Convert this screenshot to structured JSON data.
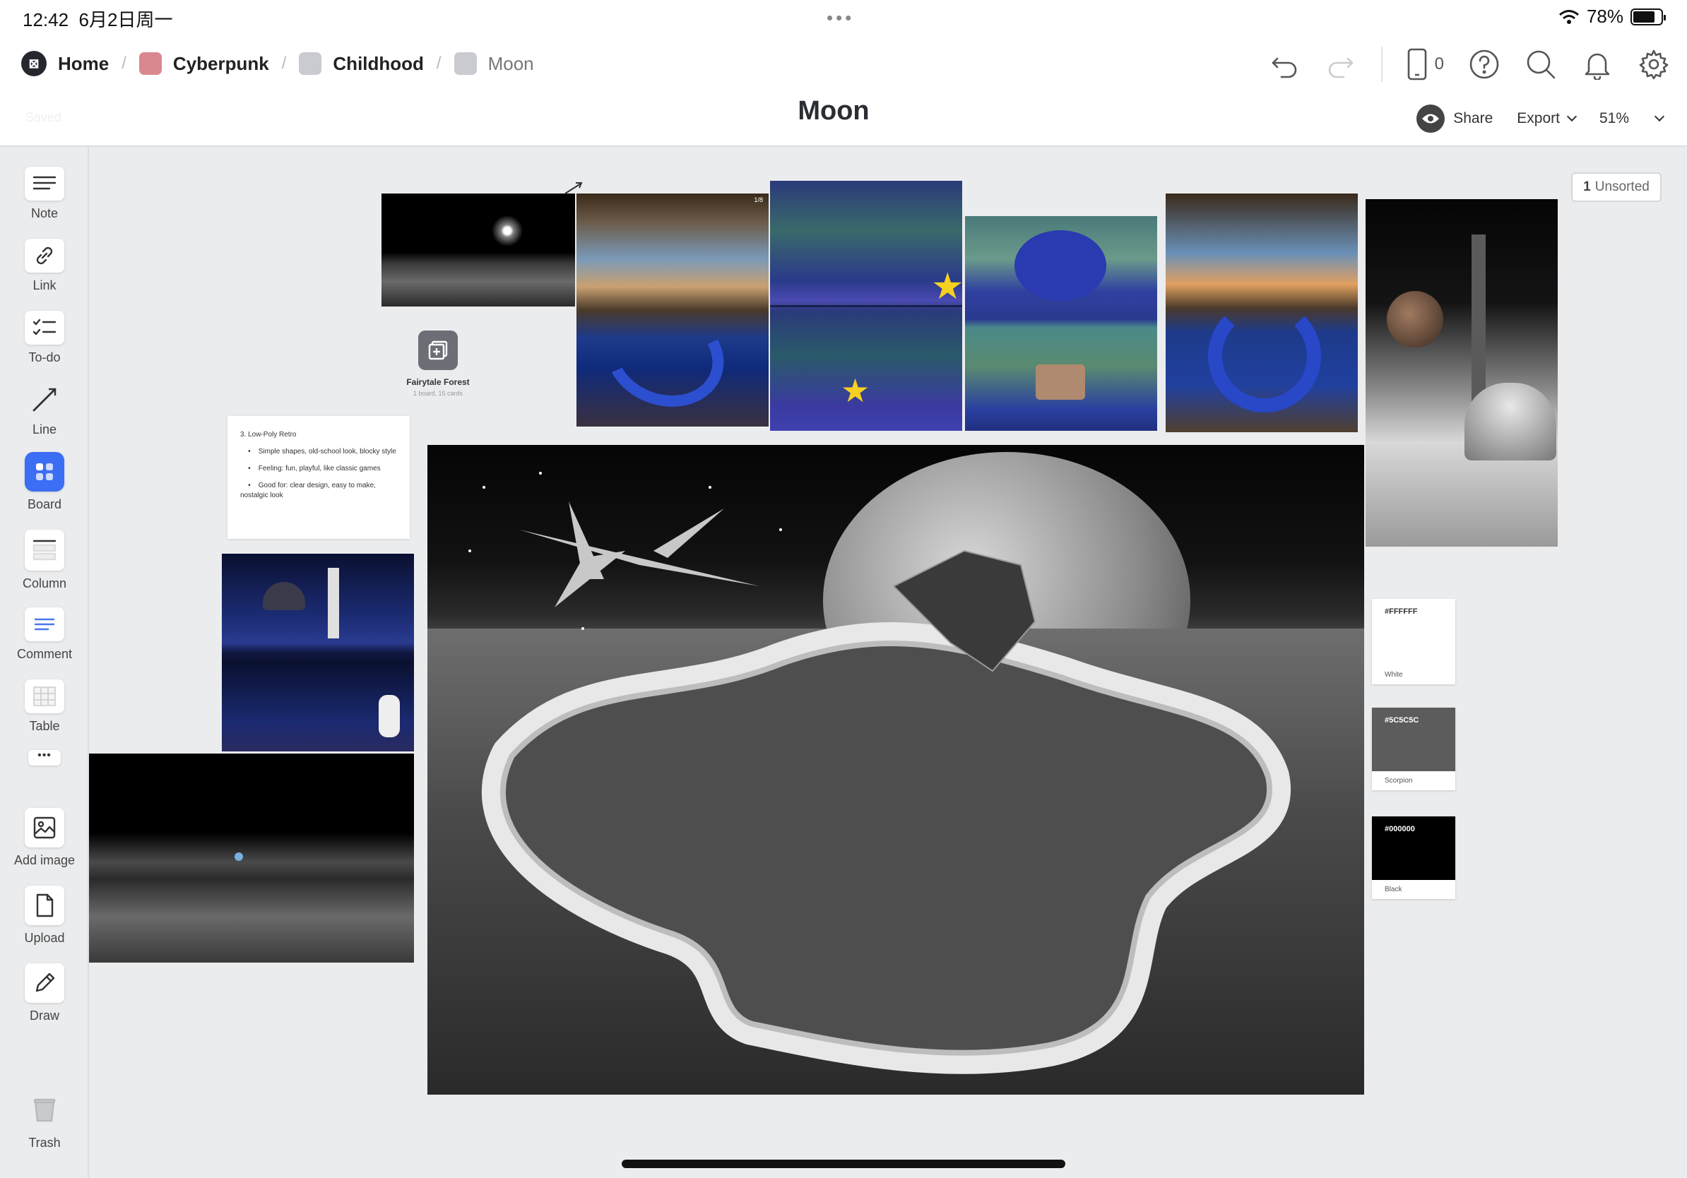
{
  "status_bar": {
    "time": "12:42",
    "date": "6月2日周一",
    "battery": "78%",
    "battery_level": 0.78
  },
  "breadcrumbs": [
    {
      "label": "Home",
      "color": "#24272e"
    },
    {
      "label": "Cyberpunk",
      "color": "#d9888f"
    },
    {
      "label": "Childhood",
      "color": "#c9cbd1"
    },
    {
      "label": "Moon",
      "color": "#c9cbd1"
    }
  ],
  "header": {
    "saved_label": "Saved",
    "title": "Moon",
    "device_count": "0",
    "share_label": "Share",
    "export_label": "Export",
    "zoom_label": "51%"
  },
  "toolbar": {
    "note": "Note",
    "link": "Link",
    "todo": "To-do",
    "line": "Line",
    "board": "Board",
    "column": "Column",
    "comment": "Comment",
    "table": "Table",
    "more": "•••",
    "add_image": "Add image",
    "upload": "Upload",
    "draw": "Draw",
    "trash": "Trash"
  },
  "canvas": {
    "unsorted_count": "1",
    "unsorted_label": "Unsorted",
    "note": {
      "heading": "3. Low-Poly Retro",
      "bullets": [
        "Simple shapes, old-school look, blocky style",
        "Feeling: fun, playful, like classic games",
        "Good for: clear design, easy to make, nostalgic look"
      ]
    },
    "board_card": {
      "title": "Fairytale Forest",
      "subtitle": "1 board, 15 cards"
    },
    "image_counter": "1/8",
    "colors": [
      {
        "hex": "#FFFFFF",
        "name": "White",
        "value": "#FFFFFF"
      },
      {
        "hex": "#5C5C5C",
        "name": "Scorpion",
        "value": "#5C5C5C"
      },
      {
        "hex": "#000000",
        "name": "Black",
        "value": "#000000"
      }
    ]
  }
}
